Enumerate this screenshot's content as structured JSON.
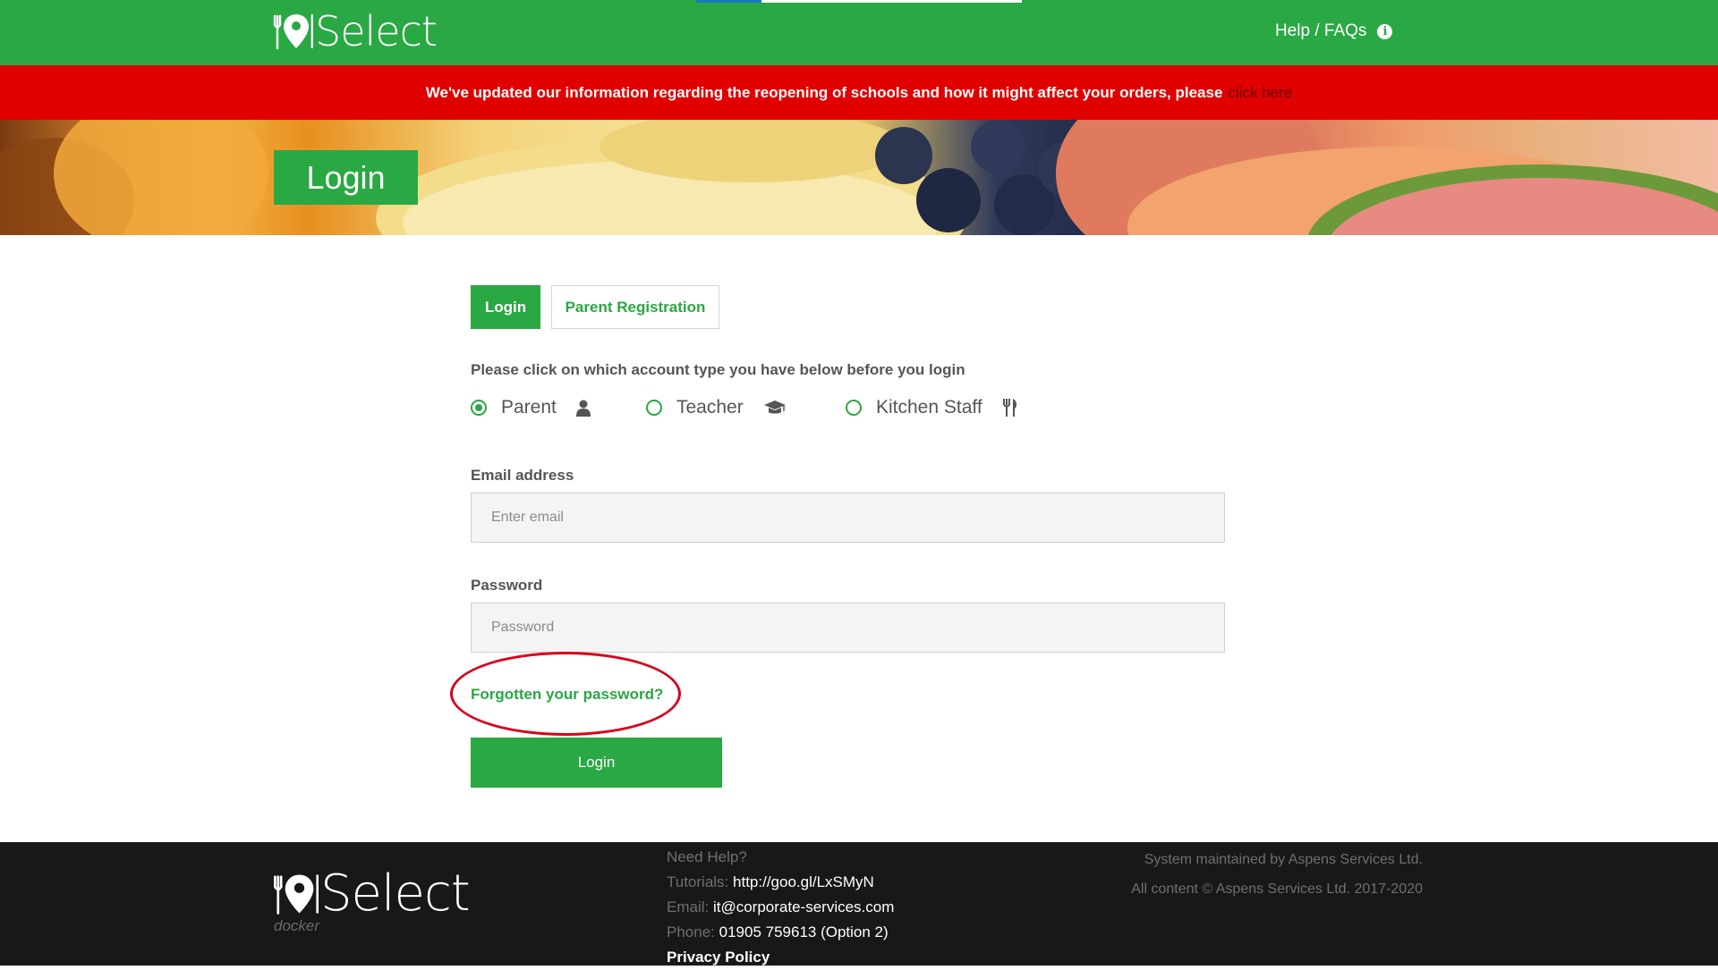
{
  "header": {
    "brand": "Select",
    "help_label": "Help / FAQs",
    "help_icon": "info-icon",
    "loading_progress": 0.2
  },
  "alert": {
    "message": "We've updated our information regarding the reopening of schools and how it might affect your orders, please",
    "link_text": "click here"
  },
  "hero": {
    "title": "Login"
  },
  "tabs": [
    {
      "label": "Login",
      "active": true
    },
    {
      "label": "Parent Registration",
      "active": false
    }
  ],
  "form": {
    "instruction": "Please click on which account type you have below before you login",
    "account_types": [
      {
        "label": "Parent",
        "icon": "user-icon",
        "selected": true
      },
      {
        "label": "Teacher",
        "icon": "graduation-cap-icon",
        "selected": false
      },
      {
        "label": "Kitchen Staff",
        "icon": "cutlery-icon",
        "selected": false
      }
    ],
    "email": {
      "label": "Email address",
      "placeholder": "Enter email",
      "value": ""
    },
    "password": {
      "label": "Password",
      "placeholder": "Password",
      "value": ""
    },
    "forgot_link": "Forgotten your password?",
    "submit_label": "Login"
  },
  "colors": {
    "brand_green": "#2aa843",
    "alert_red": "#e00000",
    "footer_bg": "#16181a",
    "annotation_red": "#d9001b"
  },
  "footer": {
    "brand": "Select",
    "sub": "docker",
    "need_help": "Need Help?",
    "tutorials_label": "Tutorials:",
    "tutorials_value": "http://goo.gl/LxSMyN",
    "email_label": "Email:",
    "email_value": "it@corporate-services.com",
    "phone_label": "Phone:",
    "phone_value": "01905 759613 (Option 2)",
    "privacy": "Privacy Policy",
    "maintained": "System maintained by Aspens Services Ltd.",
    "copyright": "All content © Aspens Services Ltd. 2017-2020"
  }
}
